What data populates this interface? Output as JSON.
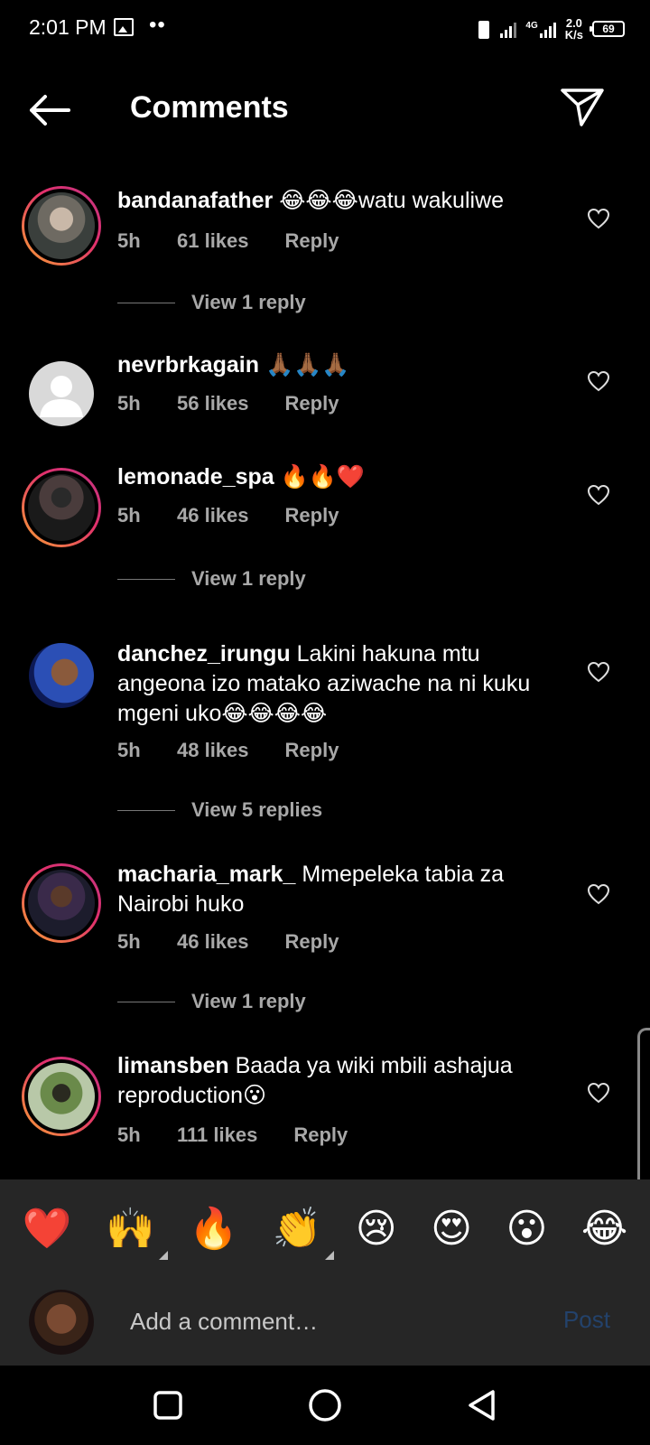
{
  "status_bar": {
    "time": "2:01 PM",
    "dots": "••",
    "net_type": "4G",
    "net_speed_value": "2.0",
    "net_speed_unit": "K/s",
    "battery": "69"
  },
  "header": {
    "title": "Comments"
  },
  "comments": [
    {
      "user": "bandanafather",
      "text": " 😂😂😂watu wakuliwe",
      "time": "5h",
      "likes": "61 likes",
      "reply": "Reply",
      "replies": "View 1 reply"
    },
    {
      "user": "nevrbrkagain",
      "text": " 🙏🏾🙏🏾🙏🏾",
      "time": "5h",
      "likes": "56 likes",
      "reply": "Reply"
    },
    {
      "user": "lemonade_spa",
      "text": " 🔥🔥❤️",
      "time": "5h",
      "likes": "46 likes",
      "reply": "Reply",
      "replies": "View 1 reply"
    },
    {
      "user": "danchez_irungu",
      "text": " Lakini hakuna mtu angeona izo matako aziwache na ni kuku mgeni uko😂😂😂😂",
      "time": "5h",
      "likes": "48 likes",
      "reply": "Reply",
      "replies": "View 5 replies"
    },
    {
      "user": "macharia_mark_",
      "text": " Mmepeleka tabia za Nairobi huko",
      "time": "5h",
      "likes": "46 likes",
      "reply": "Reply",
      "replies": "View 1 reply"
    },
    {
      "user": "limansben",
      "text": " Baada ya wiki mbili ashajua reproduction😮",
      "time": "5h",
      "likes": "111 likes",
      "reply": "Reply"
    }
  ],
  "emoji_bar": [
    "❤️",
    "🙌",
    "🔥",
    "👏",
    "😢",
    "😍",
    "😮",
    "😂"
  ],
  "composer": {
    "placeholder": "Add a comment…",
    "post_label": "Post"
  },
  "icons": {
    "back": "arrow-left-icon",
    "send": "paper-plane-icon",
    "like": "heart-outline-icon",
    "nav_home": "square-icon",
    "nav_circle": "circle-icon",
    "nav_back": "triangle-back-icon"
  }
}
